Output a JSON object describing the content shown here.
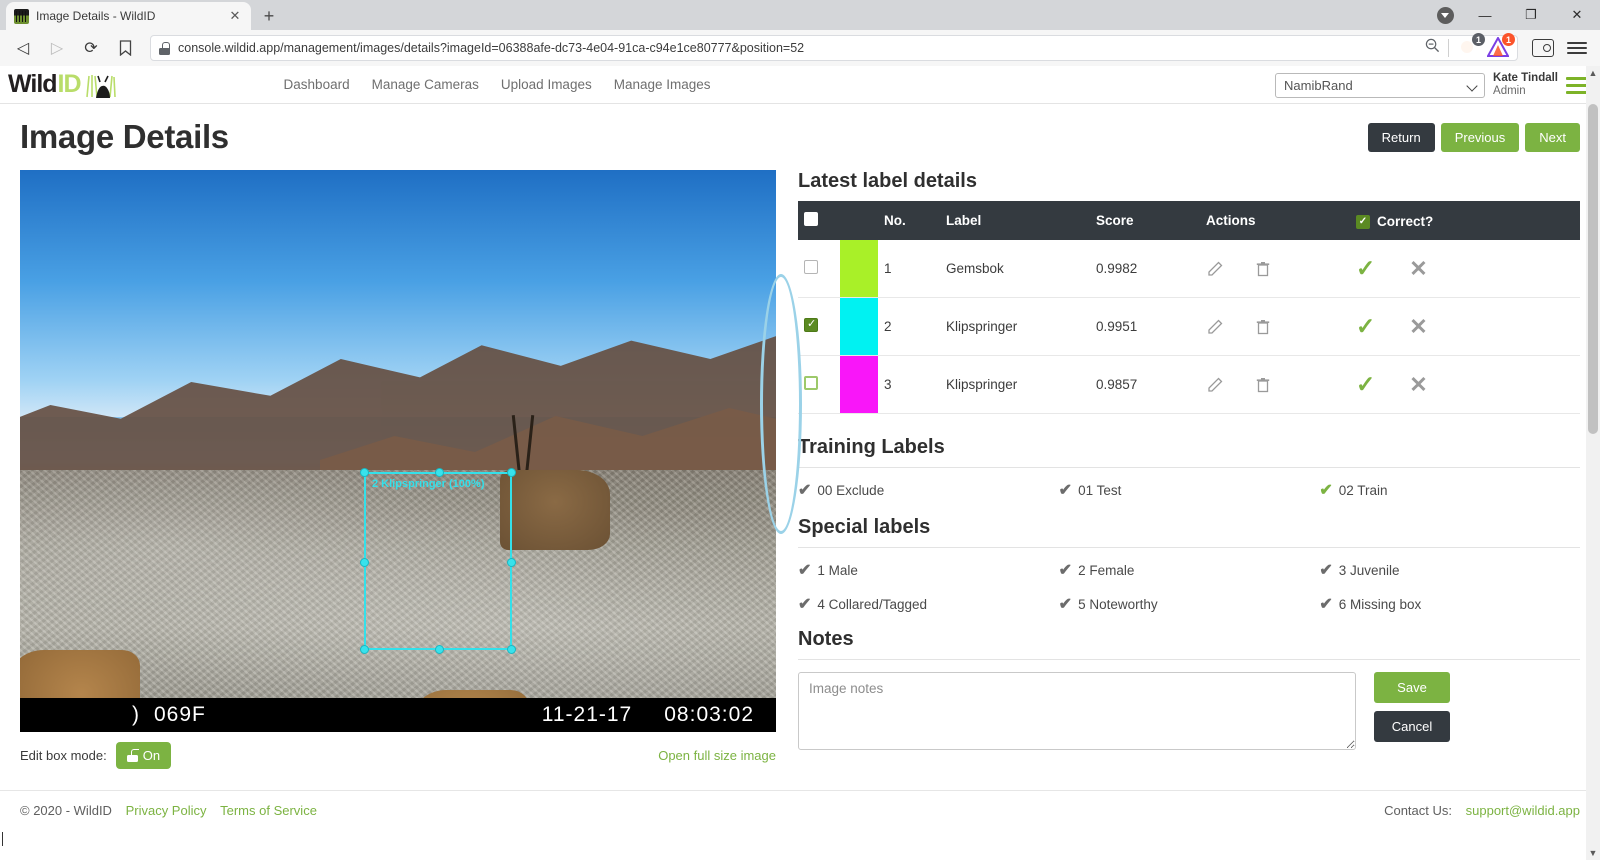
{
  "browser": {
    "tab": {
      "title": "Image Details - WildID",
      "favicon": "wildid-favicon",
      "close": "✕"
    },
    "new_tab": "+",
    "window": {
      "dropdown": "▾",
      "minimize": "—",
      "maximize": "❐",
      "close": "✕"
    },
    "nav": {
      "back": "◁",
      "forward": "▷",
      "reload": "⟳",
      "bookmark": "🔖"
    },
    "url": "console.wildid.app/management/images/details?imageId=06388afe-dc73-4e04-91ca-c94e1ce80777&position=52",
    "zoom_icon": "zoom-out-icon",
    "shields_badge": "1",
    "rewards_badge": "1"
  },
  "app": {
    "logo": {
      "part1": "Wild",
      "part2": "ID"
    },
    "nav": [
      {
        "label": "Dashboard"
      },
      {
        "label": "Manage Cameras"
      },
      {
        "label": "Upload Images"
      },
      {
        "label": "Manage Images"
      }
    ],
    "project_select": {
      "value": "NamibRand"
    },
    "user": {
      "name": "Kate Tindall",
      "role": "Admin"
    }
  },
  "page": {
    "title": "Image Details",
    "buttons": {
      "return": "Return",
      "previous": "Previous",
      "next": "Next"
    }
  },
  "photo": {
    "bbox_label": "2 Klipspringer (100%)",
    "temperature": "069F",
    "date": "11-21-17",
    "time": "08:03:02",
    "moon_glyph": ")",
    "edit_box_mode_label": "Edit box mode:",
    "edit_box_mode_value": "On",
    "full_size_link": "Open full size image"
  },
  "labels_section": {
    "heading": "Latest label details",
    "columns": {
      "check": "",
      "swatch": "",
      "no": "No.",
      "label": "Label",
      "score": "Score",
      "actions": "Actions",
      "correct": "Correct?"
    },
    "rows": [
      {
        "checked": false,
        "focus": false,
        "color": "#a9f028",
        "no": "1",
        "label": "Gemsbok",
        "score": "0.9982",
        "edit": "edit-icon",
        "delete": "delete-icon",
        "accept": "✓",
        "reject": "✕"
      },
      {
        "checked": true,
        "focus": false,
        "color": "#00f2f2",
        "no": "2",
        "label": "Klipspringer",
        "score": "0.9951",
        "edit": "edit-icon",
        "delete": "delete-icon",
        "accept": "✓",
        "reject": "✕"
      },
      {
        "checked": false,
        "focus": true,
        "color": "#f916f9",
        "no": "3",
        "label": "Klipspringer",
        "score": "0.9857",
        "edit": "edit-icon",
        "delete": "delete-icon",
        "accept": "✓",
        "reject": "✕"
      }
    ]
  },
  "training_labels": {
    "heading": "Training Labels",
    "items": [
      {
        "label": "00 Exclude",
        "active": false
      },
      {
        "label": "01 Test",
        "active": false
      },
      {
        "label": "02 Train",
        "active": true
      }
    ]
  },
  "special_labels": {
    "heading": "Special labels",
    "items": [
      {
        "label": "1 Male",
        "active": false
      },
      {
        "label": "2 Female",
        "active": false
      },
      {
        "label": "3 Juvenile",
        "active": false
      },
      {
        "label": "4 Collared/Tagged",
        "active": false
      },
      {
        "label": "5 Noteworthy",
        "active": false
      },
      {
        "label": "6 Missing box",
        "active": false
      }
    ]
  },
  "notes": {
    "heading": "Notes",
    "placeholder": "Image notes",
    "value": "",
    "save": "Save",
    "cancel": "Cancel"
  },
  "footer": {
    "copyright": "© 2020 - WildID",
    "privacy": "Privacy Policy",
    "terms": "Terms of Service",
    "contact_label": "Contact Us:",
    "contact_email": "support@wildid.app"
  },
  "colors": {
    "accent_green": "#7cb342",
    "dark": "#343a40",
    "annotation": "#9bd2e8"
  }
}
